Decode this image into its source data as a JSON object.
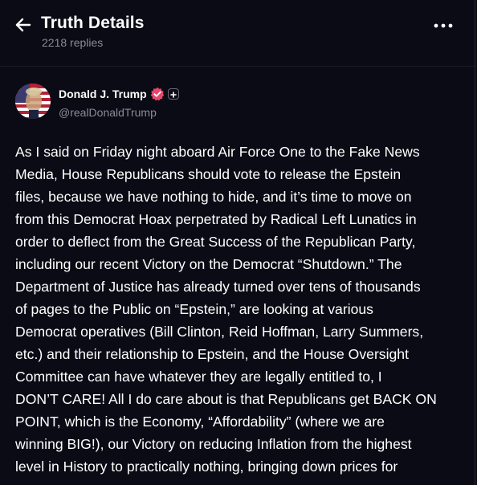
{
  "header": {
    "title": "Truth Details",
    "subtitle": "2218 replies",
    "back_icon": "arrow-left-icon",
    "more_icon": "more-horizontal-icon"
  },
  "author": {
    "name": "Donald J. Trump",
    "handle": "@realDonaldTrump",
    "verified_icon": "verified-badge-icon",
    "plus_icon": "plus-badge-icon",
    "verified_color": "#e8476b"
  },
  "post": {
    "text": "As I said on Friday night aboard Air Force One to the Fake News\nMedia, House Republicans should vote to release the Epstein\nfiles, because we have nothing to hide, and it’s time to move on\nfrom this Democrat Hoax perpetrated by Radical Left Lunatics in\norder to deflect from the Great Success of the Republican Party,\nincluding our recent Victory on the Democrat “Shutdown.” The\nDepartment of Justice has already turned over tens of thousands\nof pages to the Public on “Epstein,” are looking at various\nDemocrat operatives (Bill Clinton, Reid Hoffman, Larry Summers,\netc.) and their relationship to Epstein, and the House Oversight\nCommittee can have whatever they are legally entitled to, I\nDON’T CARE! All I do care about is that Republicans get BACK ON\nPOINT, which is the Economy, “Affordability” (where we are\nwinning BIG!), our Victory on reducing Inflation from the highest\nlevel in History to practically nothing, bringing down prices for"
  },
  "colors": {
    "background": "#0b0b16",
    "muted_text": "#8b8b99",
    "primary_text": "#ffffff"
  }
}
